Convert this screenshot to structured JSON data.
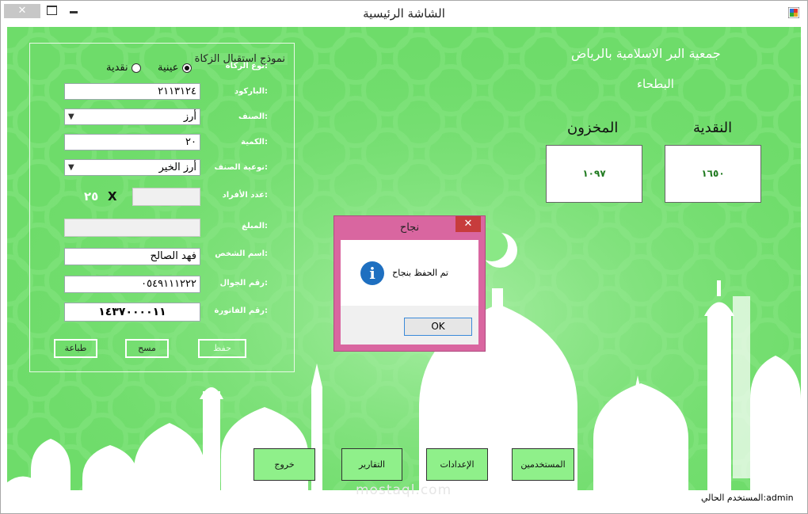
{
  "window": {
    "title": "الشاشة الرئيسية",
    "close_glyph": "✕"
  },
  "form": {
    "group_title": "نموذج استقبال الزكاة",
    "labels": {
      "zakat_type": "نوع الزكاة:",
      "barcode": "الباركود:",
      "category": "الصنف:",
      "quantity": "الكمية:",
      "category_type": "نوعية الصنف:",
      "members": "عدد الأفراد:",
      "amount": "المبلغ:",
      "person_name": "اسم الشخص:",
      "mobile": "رقم الجوال:",
      "invoice": "رقم الفاتورة:"
    },
    "zakat_options": [
      {
        "label": "عينية",
        "selected": true
      },
      {
        "label": "نقدية",
        "selected": false
      }
    ],
    "barcode_value": "٢١١٣١٢٤",
    "category_value": "أرز",
    "quantity_value": "٢٠",
    "category_type_value": "أرز الخير",
    "members_value": "",
    "multiplier_sign": "X",
    "members_factor": "٢٥",
    "amount_value": "",
    "person_name_value": "فهد الصالح",
    "mobile_value": "٠٥٤٩١١١٢٢٢",
    "invoice_value": "١٤٣٧٠٠٠٠١١",
    "buttons": {
      "save": "حفظ",
      "clear": "مسح",
      "print": "طباعة"
    }
  },
  "header": {
    "org_name": "جمعية البر الاسلامية بالرياض",
    "branch": "البطحاء"
  },
  "stats": {
    "cash_label": "النقدية",
    "cash_value": "١٦٥٠",
    "stock_label": "المخزون",
    "stock_value": "١٠٩٧"
  },
  "nav": {
    "exit": "خروج",
    "reports": "التقارير",
    "settings": "الإعدادات",
    "users": "المستخدمين"
  },
  "status": {
    "current_user": "المستخدم الحالي:admin"
  },
  "watermark": "mostaql.com",
  "dialog": {
    "title": "نجاح",
    "message": "تم الحفظ بنجاح",
    "ok": "OK",
    "close_glyph": "✕",
    "icon_glyph": "i"
  },
  "colors": {
    "background_green": "#6edc6a",
    "nav_button": "#8ff08a",
    "dialog_frame": "#d966a0",
    "dialog_close": "#c73c3c",
    "info_icon": "#1e6fc0"
  }
}
